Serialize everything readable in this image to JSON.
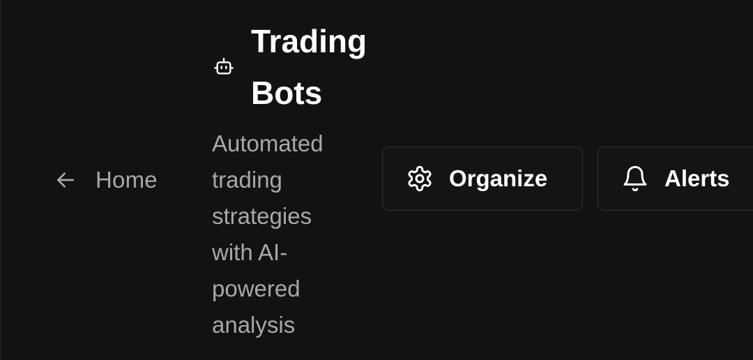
{
  "nav": {
    "back_label": "Home",
    "back_icon": "arrow-left-icon"
  },
  "header": {
    "title": "Trading Bots",
    "title_icon": "bot-icon",
    "subtitle": "Automated trading strategies with AI-powered analysis"
  },
  "actions": {
    "organize_label": "Organize",
    "organize_icon": "gear-icon",
    "alerts_label": "Alerts",
    "alerts_icon": "bell-icon"
  },
  "colors": {
    "background": "#121212",
    "muted_text": "#a8a8a8",
    "primary_text": "#ffffff",
    "button_border": "#333333"
  }
}
